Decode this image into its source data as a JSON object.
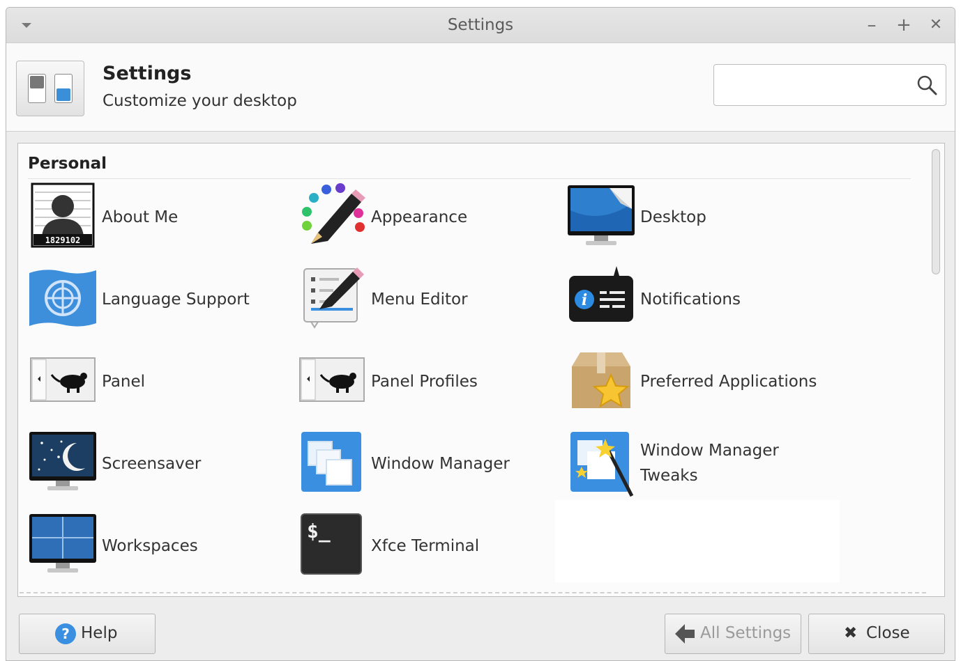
{
  "window": {
    "title": "Settings",
    "controls": [
      "–",
      "+",
      "✕"
    ]
  },
  "header": {
    "title": "Settings",
    "subtitle": "Customize your desktop",
    "search_placeholder": ""
  },
  "section": {
    "title": "Personal"
  },
  "items": [
    {
      "label": "About Me",
      "icon": "id-photo-icon",
      "badge": "1829102"
    },
    {
      "label": "Appearance",
      "icon": "palette-pencil-icon"
    },
    {
      "label": "Desktop",
      "icon": "desktop-monitor-icon"
    },
    {
      "label": "Language Support",
      "icon": "globe-flag-icon"
    },
    {
      "label": "Menu Editor",
      "icon": "menu-editor-icon"
    },
    {
      "label": "Notifications",
      "icon": "notification-icon"
    },
    {
      "label": "Panel",
      "icon": "panel-mouse-icon"
    },
    {
      "label": "Panel Profiles",
      "icon": "panel-profiles-icon"
    },
    {
      "label": "Preferred Applications",
      "icon": "box-star-icon"
    },
    {
      "label": "Screensaver",
      "icon": "screensaver-moon-icon"
    },
    {
      "label": "Window Manager",
      "icon": "window-manager-icon"
    },
    {
      "label": "Window Manager Tweaks",
      "icon": "wand-icon"
    },
    {
      "label": "Workspaces",
      "icon": "workspaces-icon"
    },
    {
      "label": "Xfce Terminal",
      "icon": "terminal-icon",
      "prompt": "$_"
    }
  ],
  "footer": {
    "help": "Help",
    "all_settings": "All Settings",
    "close": "Close"
  }
}
